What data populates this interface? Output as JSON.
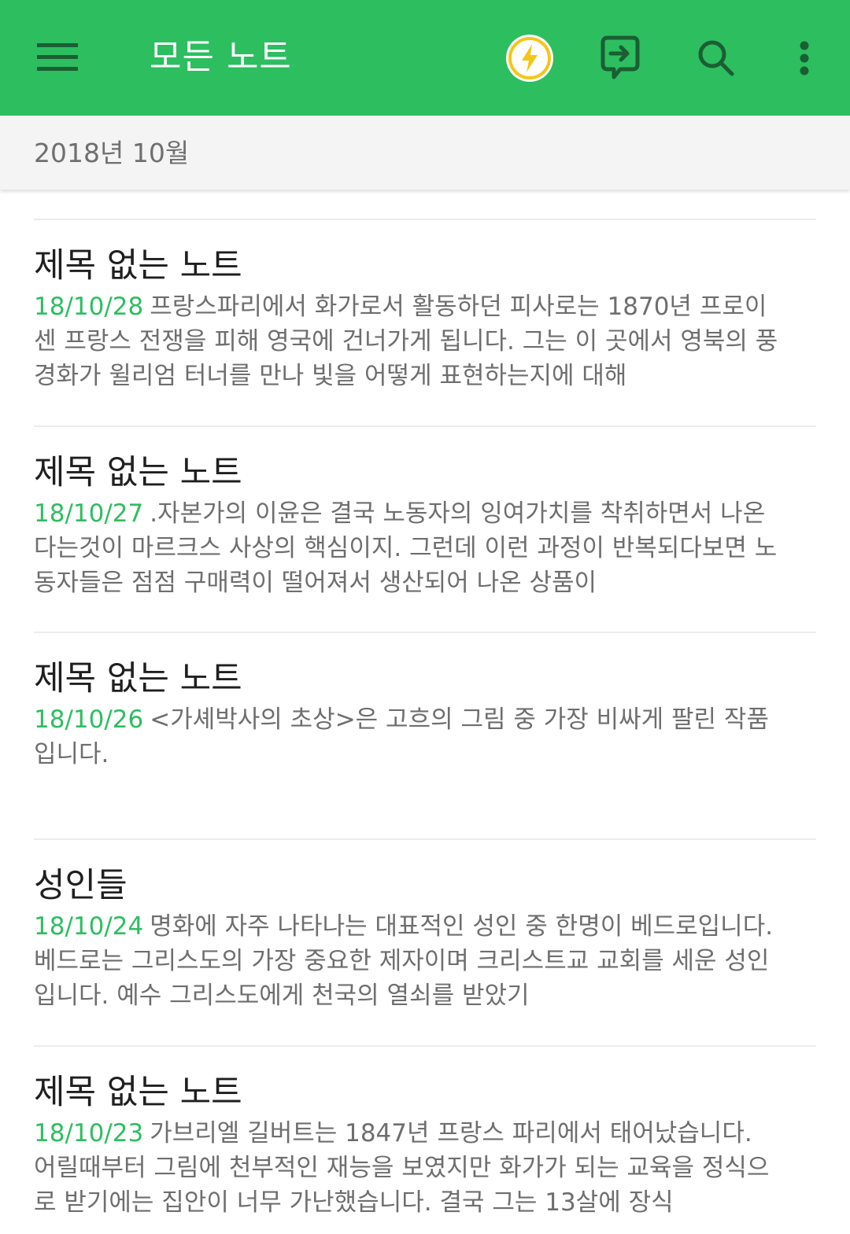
{
  "toolbar": {
    "title": "모든 노트",
    "background_color": "#2dbe60",
    "icons": {
      "menu": "hamburger-menu-icon",
      "quick": "lightning-bolt-icon",
      "share": "share-note-icon",
      "search": "search-icon",
      "more": "more-vertical-icon"
    }
  },
  "section": {
    "label": "2018년 10월"
  },
  "notes": [
    {
      "title": "제목 없는 노트",
      "date": "18/10/28",
      "snippet": "프랑스파리에서 화가로서 활동하던 피사로는 1870년 프로이센 프랑스 전쟁을 피해 영국에 건너가게 됩니다. 그는 이 곳에서 영북의 풍경화가 윌리엄 터너를 만나 빛을 어떻게 표현하는지에 대해"
    },
    {
      "title": "제목 없는 노트",
      "date": "18/10/27",
      "snippet": ".자본가의 이윤은 결국 노동자의 잉여가치를 착취하면서 나온다는것이 마르크스 사상의 핵심이지.  그런데 이런 과정이 반복되다보면 노동자들은 점점 구매력이 떨어져서 생산되어 나온 상품이"
    },
    {
      "title": "제목 없는 노트",
      "date": "18/10/26",
      "snippet": "<가셰박사의 초상>은 고흐의 그림 중 가장 비싸게 팔린 작품입니다."
    },
    {
      "title": "성인들",
      "date": "18/10/24",
      "snippet": "명화에 자주 나타나는 대표적인 성인 중 한명이 베드로입니다. 베드로는 그리스도의 가장 중요한 제자이며 크리스트교 교회를 세운 성인입니다. 예수 그리스도에게 천국의 열쇠를 받았기"
    },
    {
      "title": "제목 없는 노트",
      "date": "18/10/23",
      "snippet": "가브리엘 길버트는 1847년 프랑스 파리에서 태어났습니다. 어릴때부터 그림에 천부적인 재능을 보였지만 화가가 되는 교육을 정식으로 받기에는 집안이 너무 가난했습니다. 결국 그는 13살에 장식"
    }
  ]
}
